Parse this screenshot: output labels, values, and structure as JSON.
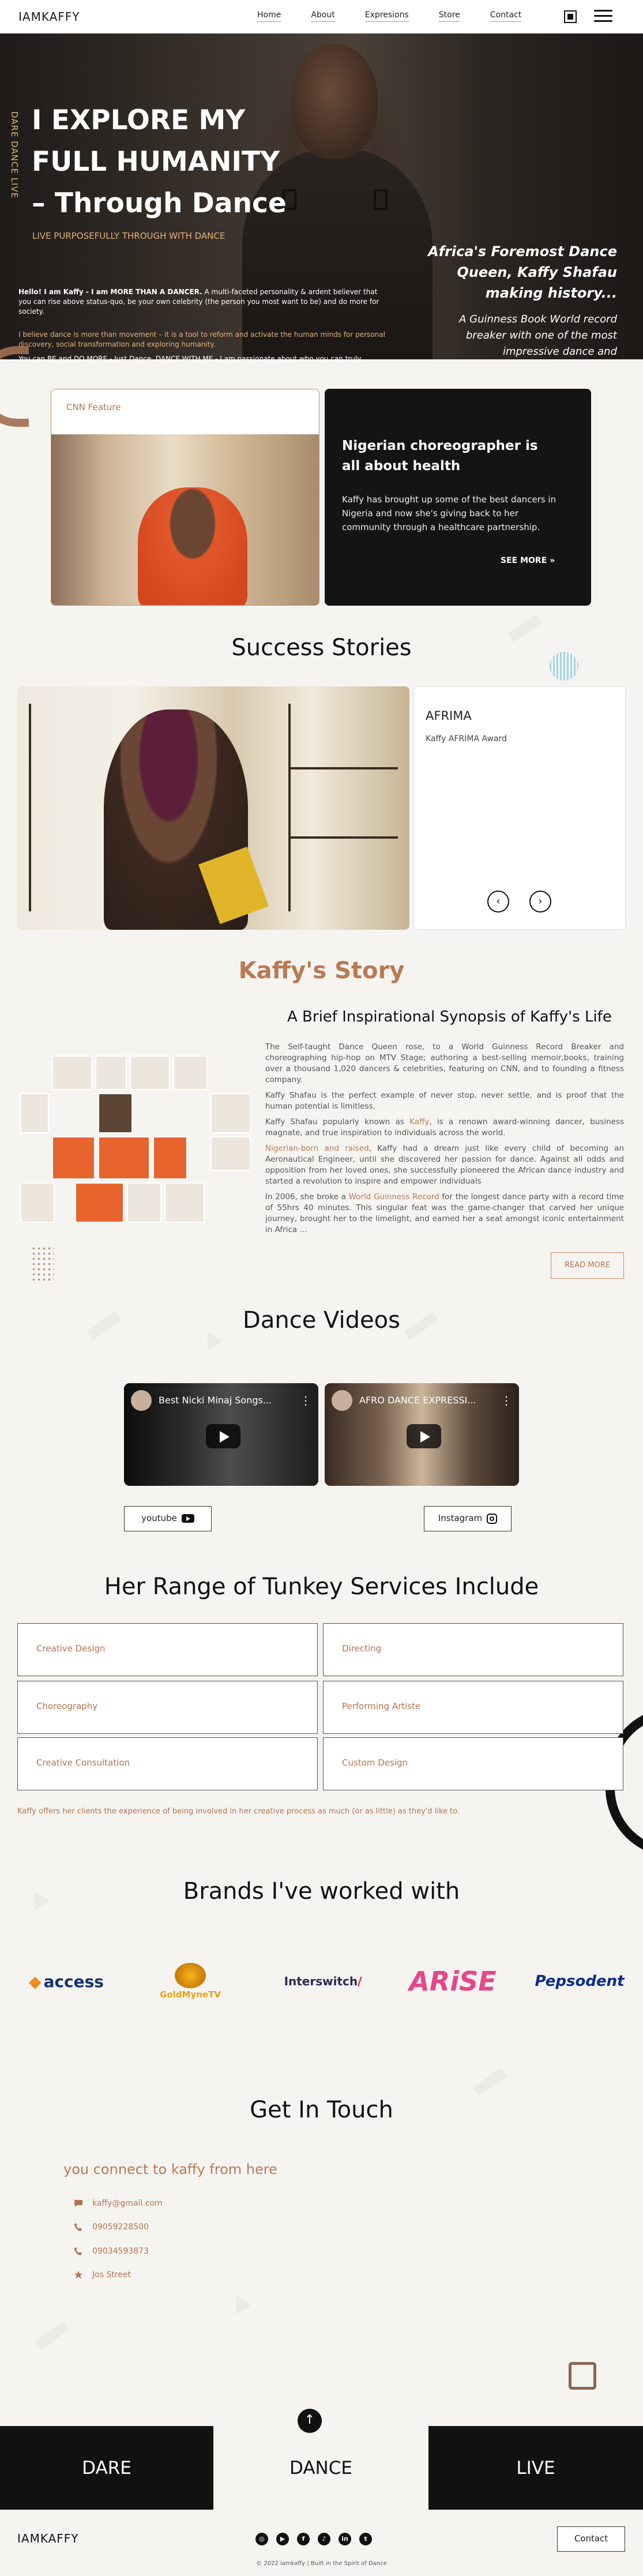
{
  "nav": {
    "brand": "IAMKAFFY",
    "links": [
      "Home",
      "About",
      "Expresions",
      "Store",
      "Contact"
    ]
  },
  "hero": {
    "vertical_text": "DARE DANCE LIVE",
    "title_line1": "I EXPLORE MY",
    "title_line2": "FULL HUMANITY",
    "title_line3": "– Through Dance",
    "subtitle": "LIVE PURPOSEFULLY THROUGH WITH DANCE",
    "intro_bold": "Hello! I am Kaffy - I am MORE THAN A DANCER.",
    "intro_rest": " A multi-faceted personality & ardent believer that you can rise above status-quo, be your own celebrity (the person you most want to be) and do more for society.",
    "belief": "I believe dance is more than movement – it is a tool to reform and activate the human minds for personal discovery, social transformation and exploring humanity.",
    "cta": "You can BE and DO MORE - Just Dance. DANCE WITH ME - I am passionate about who you can truly become.",
    "right_title": "Africa's Foremost Dance Queen, Kaffy Shafau making history...",
    "right_body": "A Guinness Book World record breaker with one of the most impressive dance and choreography careers of all times."
  },
  "cnn": {
    "label": "CNN Feature",
    "headline": "Nigerian choreographer is all about health",
    "body": "Kaffy has brought up some of the best dancers in Nigeria and now she's giving back to her community through a healthcare partnership.",
    "see_more": "SEE MORE"
  },
  "success": {
    "heading": "Success Stories",
    "card_title": "AFRIMA",
    "card_sub": "Kaffy AFRIMA Award",
    "prev": "‹",
    "next": "›"
  },
  "story": {
    "heading": "Kaffy's Story",
    "subheading": "A Brief Inspirational Synopsis of Kaffy's Life",
    "p1": "The Self-taught Dance Queen rose, to a World Guinness Record Breaker and choreographing hip-hop on MTV Stage; authoring a best-selling memoir,books, training over a thousand 1,020 dancers & celebrities, featuring on CNN, and to founding a fitness company.",
    "p2": "Kaffy Shafau is the perfect example of never stop, never settle, and is proof that the human potential is limitless.",
    "p3_a": "Kaffy Shafau popularly known as ",
    "p3_hl": "Kaffy",
    "p3_b": ", is a renown award-winning dancer, business magnate, and true inspiration to individuals across the world.",
    "p4_hl": "Nigerian-born and raised",
    "p4_b": ", Kaffy had a dream just like every child of becoming an Aeronautical Engineer, until she discovered her passion for dance. Against all odds and opposition from her loved ones, she successfully pioneered the African dance industry and started a revolution to inspire and empower individuals",
    "p5_a": "In 2006, she broke a ",
    "p5_hl": "World Guinness Record",
    "p5_b": " for the longest dance party with a record time of 55hrs 40 minutes. This singular feat was the game-changer that carved her unique journey, brought her to the limelight, and earned her a seat amongst iconic entertainment in Africa ...",
    "read_more": "READ MORE"
  },
  "videos": {
    "heading": "Dance Videos",
    "items": [
      {
        "title": "Best Nicki Minaj Songs..."
      },
      {
        "title": "AFRO DANCE EXPRESSI..."
      }
    ],
    "youtube": "youtube",
    "instagram": "Instagram"
  },
  "services": {
    "heading": "Her Range of Tunkey Services Include",
    "items": [
      "Creative Design",
      "Directing",
      "Choreography",
      "Performing Artiste",
      "Creative Consultation",
      "Custom Design"
    ],
    "note": "Kaffy offers her clients the experience of being involved in her creative process as much (or as little) as they'd like to."
  },
  "brands": {
    "heading": "Brands I've worked with",
    "logos": [
      "access",
      "GoldMyneTV",
      "Interswitch",
      "ARiSE",
      "Pepsodent"
    ]
  },
  "contact": {
    "heading": "Get In Touch",
    "lead": "you connect to kaffy from here",
    "email": "kaffy@gmail.com",
    "phone1": "09059228500",
    "phone2": "09034593873",
    "address": "Jos Street"
  },
  "footer": {
    "words": [
      "DARE",
      "DANCE",
      "LIVE"
    ],
    "brand": "IAMKAFFY",
    "contact_btn": "Contact",
    "copyright": "© 2022 iamkaffy  |  Built in the Spirit of Dance",
    "social": [
      "instagram-icon",
      "youtube-icon",
      "facebook-icon",
      "tiktok-icon",
      "linkedin-icon",
      "twitter-icon"
    ]
  },
  "colors": {
    "accent": "#b97a53",
    "dark": "#111111",
    "bg": "#f6f4f1"
  }
}
